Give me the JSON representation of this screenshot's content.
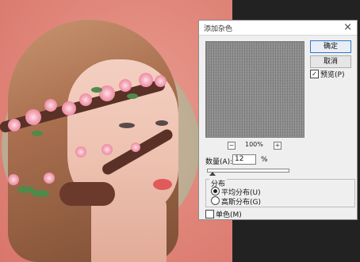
{
  "dialog": {
    "title": "添加杂色",
    "ok_label": "确定",
    "cancel_label": "取消",
    "preview_label": "预览(P)",
    "preview_checked": true,
    "zoom_level": "100%",
    "zoom_minus": "−",
    "zoom_plus": "+",
    "amount_label": "数量(A):",
    "amount_value": "12",
    "amount_unit": "%",
    "distribution": {
      "title": "分布",
      "options": [
        {
          "label": "平均分布(U)",
          "selected": true
        },
        {
          "label": "高斯分布(G)",
          "selected": false
        }
      ]
    },
    "monochromatic_label": "单色(M)",
    "monochromatic_checked": false
  },
  "icons": {
    "close": "close-icon",
    "checkmark": "checkmark-icon"
  },
  "colors": {
    "background_pink": "#e08579",
    "dialog_bg": "#efefef",
    "ok_border": "#2f78cc"
  }
}
